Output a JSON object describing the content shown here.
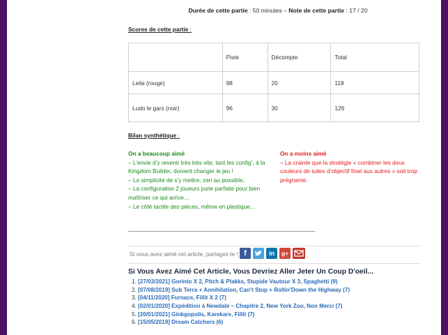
{
  "meta": {
    "duration_label": "Durée de cette partie",
    "duration_value": " : 50 minutes – ",
    "note_label": "Note de cette partie",
    "note_value": " : 17 / 20"
  },
  "scores": {
    "title": "Scores de cette partie",
    "colon": " :",
    "headers": [
      "",
      "Piste",
      "Décompte",
      "Total"
    ],
    "rows": [
      [
        "Leila (rouge)",
        "98",
        "20",
        "118"
      ],
      [
        "Ludo le gars (noir)",
        "96",
        "30",
        "126"
      ]
    ]
  },
  "bilan": {
    "title": "Bilan synthétique",
    "colon": " :",
    "liked_title": "On a beaucoup aimé",
    "liked_items": [
      "– L’envie d’y revenir très très vite, tant les config’, à la Kingdom Builder, doivent changer le jeu !",
      "– La simplicité de s’y mettre, zen au possible,",
      "– La configuration 2 joueurs juste parfaite pour bien maîtriser ce qui arrive…",
      "– Le côté tactile des pièces, même en plastique…"
    ],
    "disliked_title": "On a moins aimé",
    "disliked_items": [
      "– La crainte que la stratégie « combiner les deux couleurs de tuiles d’objectif final aux autres » soit trop prégnante."
    ]
  },
  "share": {
    "label": "Si vous avez aimé cet article, partagez-le !",
    "icons": [
      "facebook-icon",
      "twitter-icon",
      "linkedin-icon",
      "google-plus-icon",
      "email-icon"
    ]
  },
  "related": {
    "title": "Si Vous Avez Aimé Cet Article, Vous Devriez Aller Jeter Un Coup D'oeil...",
    "items": [
      "[27/03/2021] Gorinto X 2, Pitch & Plakks, Stupide Vautour X 3, Spaghetti (9)",
      "[07/08/2019] Sub Terra + Annihilation, Can’t Stop + Rollin’Down the Highway (7)",
      "[04/11/2020] Furnace, Fillit X 2 (7)",
      "[02/01/2020] Expédition à Newdale – Chapitre 2, New York Zoo, Non Merci (7)",
      "[20/01/2021] Ginkgopolis, Karekare, Fillit (7)",
      "[15/05/2019] Dream Catchers (6)"
    ]
  },
  "colors": {
    "background": "#4b1060",
    "liked": "#1a8a1a",
    "disliked": "#e21a1a",
    "link": "#2a6bb6"
  }
}
